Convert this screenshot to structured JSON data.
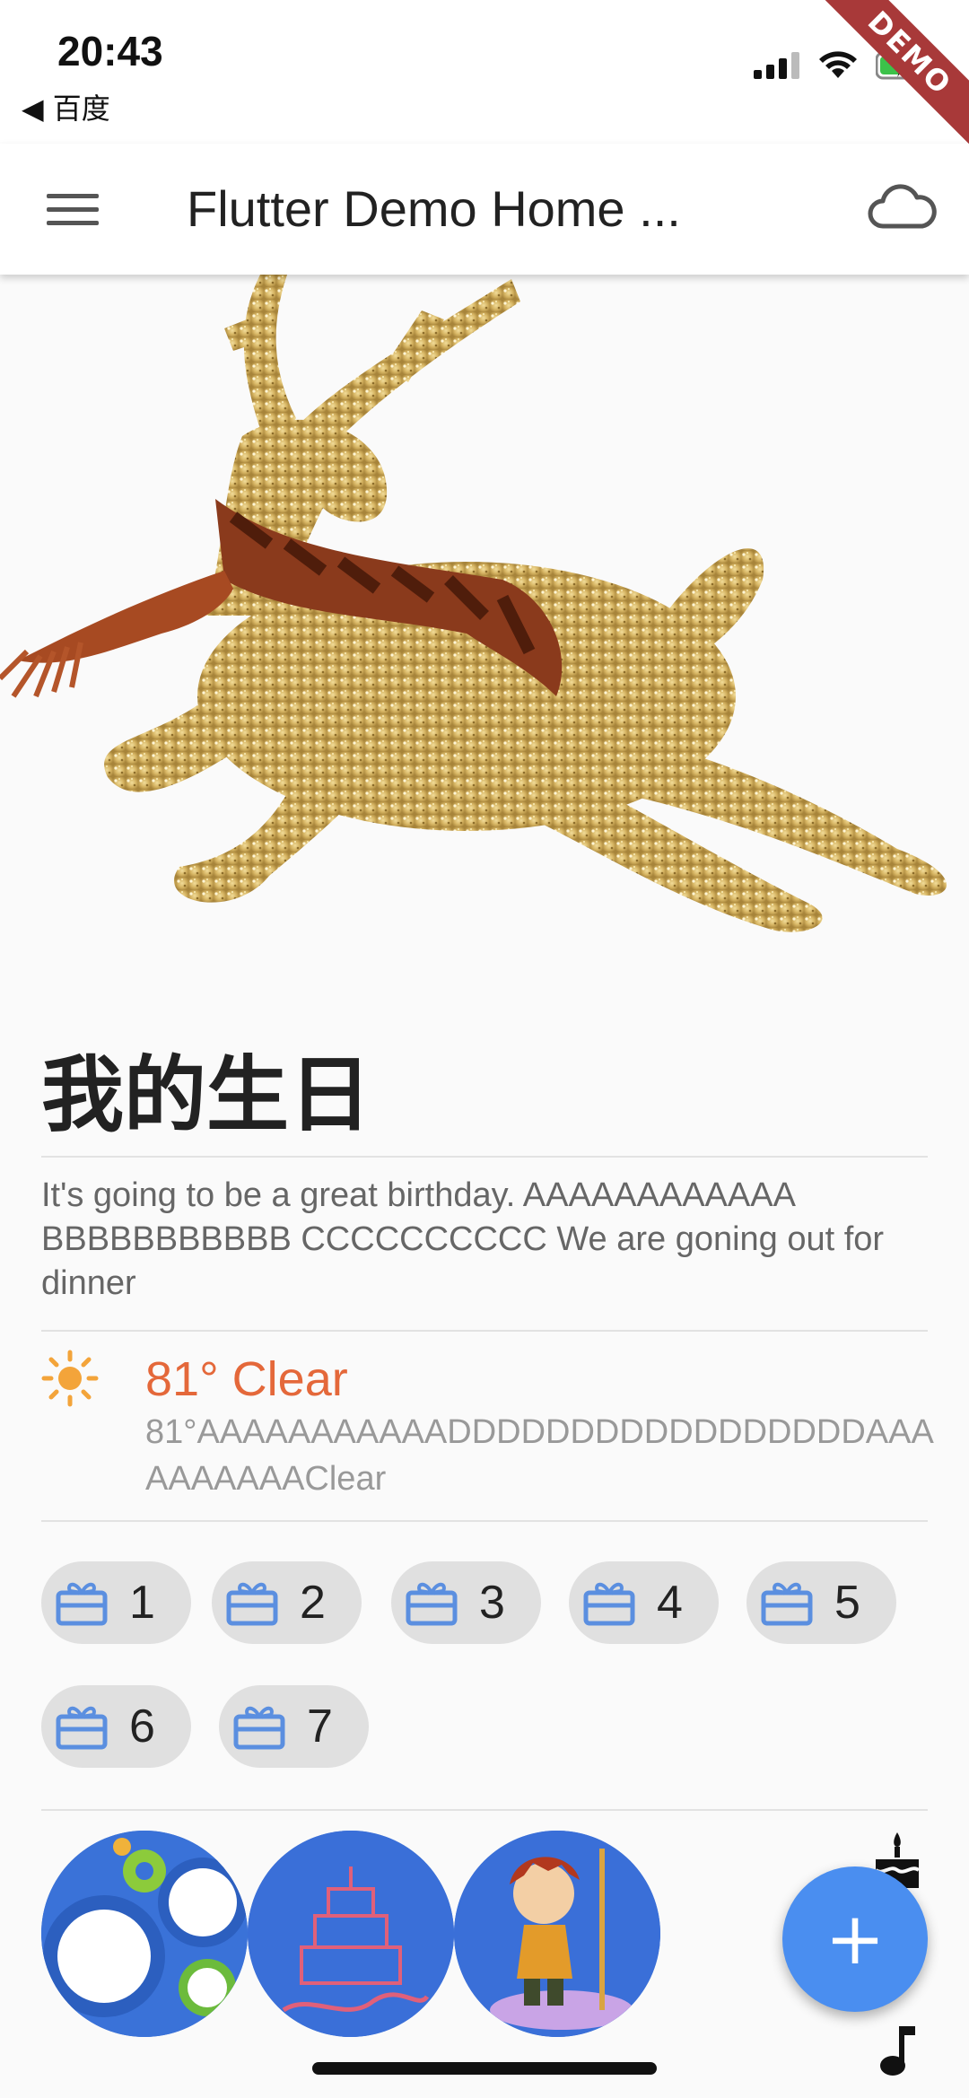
{
  "status_bar": {
    "time": "20:43",
    "back_label": "◀ 百度",
    "ribbon": "DEMO"
  },
  "app_bar": {
    "title": "Flutter Demo Home ...",
    "menu_icon": "menu-icon",
    "action_icon": "cloud-icon"
  },
  "card": {
    "title": "我的生日",
    "description": "It's going to be a great birthday. AAAAAAAAAAAA BBBBBBBBBBB CCCCCCCCCC We are goning out for dinner",
    "weather": {
      "icon": "sun-icon",
      "headline": "81° Clear",
      "detail": "81°AAAAAAAAAAADDDDDDDDDDDDDDDDDAAAAAAAAAAClear"
    },
    "chips": [
      {
        "label": "1",
        "icon": "gift-icon"
      },
      {
        "label": "2",
        "icon": "gift-icon"
      },
      {
        "label": "3",
        "icon": "gift-icon"
      },
      {
        "label": "4",
        "icon": "gift-icon"
      },
      {
        "label": "5",
        "icon": "gift-icon"
      },
      {
        "label": "6",
        "icon": "gift-icon"
      },
      {
        "label": "7",
        "icon": "gift-icon"
      }
    ],
    "avatars": [
      "gears-avatar",
      "birthday-cake-avatar",
      "cartoon-warrior-avatar"
    ],
    "side_icons": [
      "cake-icon",
      "music-note-icon"
    ]
  },
  "fab": {
    "label": "+"
  },
  "colors": {
    "accent": "#4a8ef0",
    "weather_text": "#e4683a",
    "chip_icon": "#5b8fe0",
    "ribbon": "#a83939"
  }
}
